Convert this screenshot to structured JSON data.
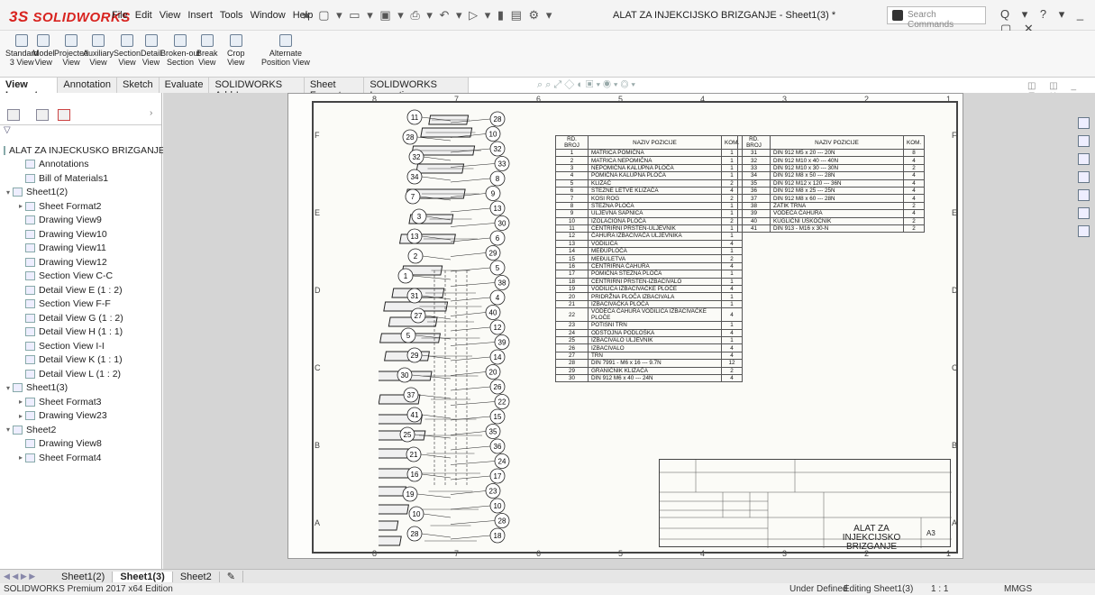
{
  "app": {
    "logo_prefix": "3S",
    "logo_text": "SOLIDWORKS",
    "title": "ALAT ZA INJEKCIJSKO BRIZGANJE - Sheet1(3) *"
  },
  "menu": [
    "File",
    "Edit",
    "View",
    "Insert",
    "Tools",
    "Window",
    "Help"
  ],
  "search": {
    "placeholder": "Search Commands"
  },
  "ribbon": [
    {
      "l1": "Standard",
      "l2": "3 View"
    },
    {
      "l1": "Model",
      "l2": "View"
    },
    {
      "l1": "Projected",
      "l2": "View"
    },
    {
      "l1": "Auxiliary",
      "l2": "View"
    },
    {
      "l1": "Section",
      "l2": "View"
    },
    {
      "l1": "Detail",
      "l2": "View"
    },
    {
      "l1": "Broken-out",
      "l2": "Section"
    },
    {
      "l1": "Break",
      "l2": "View"
    },
    {
      "l1": "Crop",
      "l2": "View"
    },
    {
      "l1": "Alternate",
      "l2": "Position View"
    }
  ],
  "cm_tabs": [
    "View Layout",
    "Annotation",
    "Sketch",
    "Evaluate",
    "SOLIDWORKS Add-Ins",
    "Sheet Format",
    "SOLIDWORKS Inspection"
  ],
  "tree": [
    {
      "label": "ALAT ZA INJECKUSKO BRIZGANJE",
      "level": 0,
      "exp": ""
    },
    {
      "label": "Annotations",
      "level": 1,
      "exp": ""
    },
    {
      "label": "Bill of Materials1",
      "level": 1,
      "exp": ""
    },
    {
      "label": "Sheet1(2)",
      "level": 0,
      "exp": "▾"
    },
    {
      "label": "Sheet Format2",
      "level": 1,
      "exp": "▸"
    },
    {
      "label": "Drawing View9",
      "level": 1,
      "exp": ""
    },
    {
      "label": "Drawing View10",
      "level": 1,
      "exp": ""
    },
    {
      "label": "Drawing View11",
      "level": 1,
      "exp": ""
    },
    {
      "label": "Drawing View12",
      "level": 1,
      "exp": ""
    },
    {
      "label": "Section View C-C",
      "level": 1,
      "exp": ""
    },
    {
      "label": "Detail View E (1 : 2)",
      "level": 1,
      "exp": ""
    },
    {
      "label": "Section View F-F",
      "level": 1,
      "exp": ""
    },
    {
      "label": "Detail View G (1 : 2)",
      "level": 1,
      "exp": ""
    },
    {
      "label": "Detail View H (1 : 1)",
      "level": 1,
      "exp": ""
    },
    {
      "label": "Section View I-I",
      "level": 1,
      "exp": ""
    },
    {
      "label": "Detail View K (1 : 1)",
      "level": 1,
      "exp": ""
    },
    {
      "label": "Detail View L (1 : 2)",
      "level": 1,
      "exp": ""
    },
    {
      "label": "Sheet1(3)",
      "level": 0,
      "exp": "▾"
    },
    {
      "label": "Sheet Format3",
      "level": 1,
      "exp": "▸"
    },
    {
      "label": "Drawing View23",
      "level": 1,
      "exp": "▸"
    },
    {
      "label": "Sheet2",
      "level": 0,
      "exp": "▾"
    },
    {
      "label": "Drawing View8",
      "level": 1,
      "exp": ""
    },
    {
      "label": "Sheet Format4",
      "level": 1,
      "exp": "▸"
    }
  ],
  "zones_top": [
    "8",
    "7",
    "6",
    "5",
    "4",
    "3",
    "2",
    "1"
  ],
  "zones_side": [
    "F",
    "E",
    "D",
    "C",
    "B",
    "A"
  ],
  "bom_headers": [
    "RD. BROJ",
    "NAZIV POZICIJE",
    "KOM."
  ],
  "bom_left": [
    [
      "1",
      "MATRICA POMIČNA",
      "1"
    ],
    [
      "2",
      "MATRICA NEPOMIČNA",
      "1"
    ],
    [
      "3",
      "NEPOMIČNA KALUPNA PLOČA",
      "1"
    ],
    [
      "4",
      "POMIČNA KALUPNA PLOČA",
      "1"
    ],
    [
      "5",
      "KLIZAČ",
      "2"
    ],
    [
      "6",
      "STEZNE LETVE KLIZAČA",
      "4"
    ],
    [
      "7",
      "KOSI ROG",
      "2"
    ],
    [
      "8",
      "STEZNA PLOČA",
      "1"
    ],
    [
      "9",
      "ULJEVNA SAPNICA",
      "1"
    ],
    [
      "10",
      "IZOLACIONA PLOČA",
      "2"
    ],
    [
      "11",
      "CENTRIRNI PRSTEN-ULJEVNIK",
      "1"
    ],
    [
      "12",
      "ČAHURA IZBACIVAČA ULJEVNIKA",
      "1"
    ],
    [
      "13",
      "VODILICA",
      "4"
    ],
    [
      "14",
      "MEĐUPLOČA",
      "1"
    ],
    [
      "15",
      "MEĐULETVA",
      "2"
    ],
    [
      "16",
      "CENTRIRNA ČAHURA",
      "4"
    ],
    [
      "17",
      "POMIČNA STEZNA PLOČA",
      "1"
    ],
    [
      "18",
      "CENTRIRNI PRSTEN-IZBACIVALO",
      "1"
    ],
    [
      "19",
      "VODILICA IZBACIVAČKE PLOČE",
      "4"
    ],
    [
      "20",
      "PRIDRŽNA PLOČA IZBACIVALA",
      "1"
    ],
    [
      "21",
      "IZBACIVAČKA PLOČA",
      "1"
    ],
    [
      "22",
      "VODEĆA ČAHURA VODILICA IZBACIVAČKE PLOČE",
      "4"
    ],
    [
      "23",
      "POTISNI TRN",
      "1"
    ],
    [
      "24",
      "ODSTOJNA PODLOŠKA",
      "4"
    ],
    [
      "25",
      "IZBACIVALO ULJEVNIK",
      "1"
    ],
    [
      "26",
      "IZBACIVALO",
      "4"
    ],
    [
      "27",
      "TRN",
      "4"
    ],
    [
      "28",
      "DIN 7991 - M6 x 16 --- 9.7N",
      "12"
    ],
    [
      "29",
      "GRANIČNIK KLIZAČA",
      "2"
    ],
    [
      "30",
      "DIN 912 M6 x 40 --- 24N",
      "4"
    ]
  ],
  "bom_right": [
    [
      "31",
      "DIN 912 M5 x 20 --- 20N",
      "8"
    ],
    [
      "32",
      "DIN 912 M10 x 40 --- 40N",
      "4"
    ],
    [
      "33",
      "DIN 912 M10 x 30 --- 30N",
      "2"
    ],
    [
      "34",
      "DIN 912 M8 x 50 --- 28N",
      "4"
    ],
    [
      "35",
      "DIN 912 M12 x 120 --- 36N",
      "4"
    ],
    [
      "36",
      "DIN 912 M8 x 25 --- 25N",
      "4"
    ],
    [
      "37",
      "DIN 912 M8 x 60 --- 28N",
      "4"
    ],
    [
      "38",
      "ZATIK TRNA",
      "2"
    ],
    [
      "39",
      "VODEĆA ČAHURA",
      "4"
    ],
    [
      "40",
      "KUGLIČNI USKOČNIK",
      "2"
    ],
    [
      "41",
      "DIN 913 - M16 x 30-N",
      "2"
    ]
  ],
  "balloons_left": [
    "11",
    "28",
    "32",
    "34",
    "7",
    "3",
    "13",
    "2",
    "1",
    "31",
    "27",
    "5",
    "29",
    "30",
    "37",
    "41",
    "25",
    "21",
    "16",
    "19",
    "10",
    "28"
  ],
  "balloons_right": [
    "28",
    "10",
    "32",
    "33",
    "8",
    "9",
    "13",
    "30",
    "6",
    "29",
    "5",
    "38",
    "4",
    "40",
    "12",
    "39",
    "14",
    "20",
    "26",
    "22",
    "15",
    "35",
    "36",
    "24",
    "17",
    "23",
    "10",
    "28",
    "18"
  ],
  "title_block": {
    "title": "ALAT ZA INJEKCIJSKO BRIZGANJE",
    "size": "A3"
  },
  "sheet_tabs": [
    "Sheet1(2)",
    "Sheet1(3)",
    "Sheet2"
  ],
  "status": {
    "edition": "SOLIDWORKS Premium 2017 x64 Edition",
    "state": "Under Defined",
    "editing": "Editing Sheet1(3)",
    "scale": "1 : 1",
    "units": "MMGS"
  }
}
